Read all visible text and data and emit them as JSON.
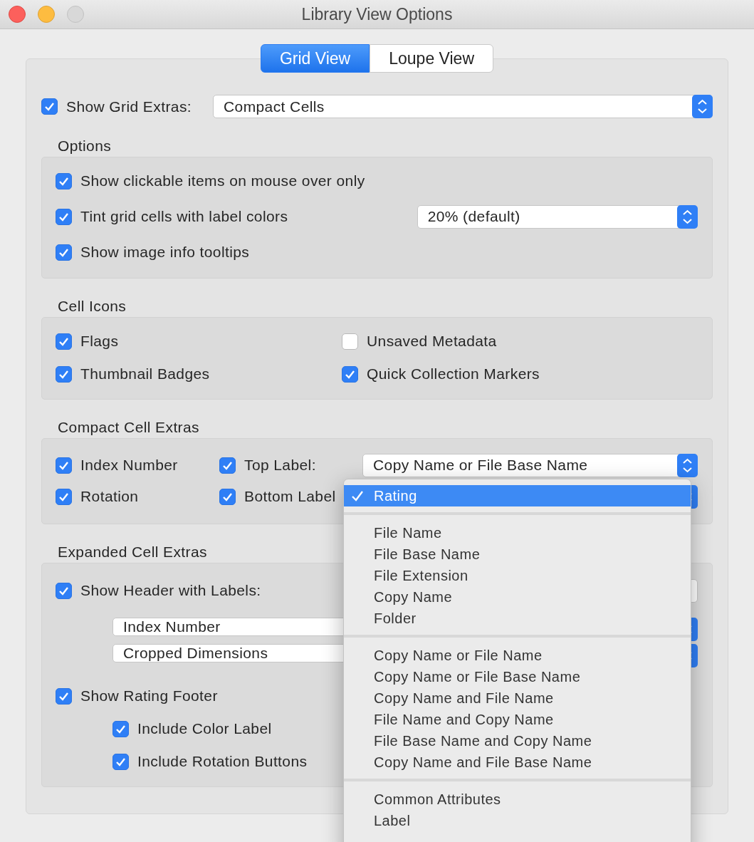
{
  "window": {
    "title": "Library View Options"
  },
  "tabs": [
    {
      "label": "Grid View",
      "selected": true
    },
    {
      "label": "Loupe View",
      "selected": false
    }
  ],
  "grid_extras": {
    "label": "Show Grid Extras:",
    "checked": true,
    "value": "Compact Cells"
  },
  "options": {
    "title": "Options",
    "items": [
      {
        "label": "Show clickable items on mouse over only",
        "checked": true
      },
      {
        "label": "Tint grid cells with label colors",
        "checked": true,
        "dropdown": "20% (default)"
      },
      {
        "label": "Show image info tooltips",
        "checked": true
      }
    ]
  },
  "cell_icons": {
    "title": "Cell Icons",
    "items": [
      {
        "label": "Flags",
        "checked": true
      },
      {
        "label": "Unsaved Metadata",
        "checked": false
      },
      {
        "label": "Thumbnail Badges",
        "checked": true
      },
      {
        "label": "Quick Collection Markers",
        "checked": true
      }
    ]
  },
  "compact_cell_extras": {
    "title": "Compact Cell Extras",
    "rows": [
      {
        "left": {
          "label": "Index Number",
          "checked": true
        },
        "right": {
          "label": "Top Label:",
          "checked": true
        },
        "dropdown": "Copy Name or File Base Name"
      },
      {
        "left": {
          "label": "Rotation",
          "checked": true
        },
        "right": {
          "label": "Bottom Label",
          "checked": true
        }
      }
    ]
  },
  "expanded_cell_extras": {
    "title": "Expanded Cell Extras",
    "header": {
      "label": "Show Header with Labels:",
      "checked": true
    },
    "header_fields": [
      "Index Number",
      "Cropped Dimensions"
    ],
    "footer": {
      "label": "Show Rating Footer",
      "checked": true
    },
    "footer_options": [
      {
        "label": "Include Color Label",
        "checked": true
      },
      {
        "label": "Include Rotation Buttons",
        "checked": true
      }
    ]
  },
  "menu": {
    "groups": [
      [
        {
          "label": "Rating",
          "selected": true
        }
      ],
      [
        {
          "label": "File Name",
          "selected": false
        },
        {
          "label": "File Base Name",
          "selected": false
        },
        {
          "label": "File Extension",
          "selected": false
        },
        {
          "label": "Copy Name",
          "selected": false
        },
        {
          "label": "Folder",
          "selected": false
        }
      ],
      [
        {
          "label": "Copy Name or File Name",
          "selected": false
        },
        {
          "label": "Copy Name or File Base Name",
          "selected": false
        },
        {
          "label": "Copy Name and File Name",
          "selected": false
        },
        {
          "label": "File Name and Copy Name",
          "selected": false
        },
        {
          "label": "File Base Name and Copy Name",
          "selected": false
        },
        {
          "label": "Copy Name and File Base Name",
          "selected": false
        }
      ],
      [
        {
          "label": "Common Attributes",
          "selected": false
        },
        {
          "label": "Label",
          "selected": false
        }
      ]
    ]
  }
}
